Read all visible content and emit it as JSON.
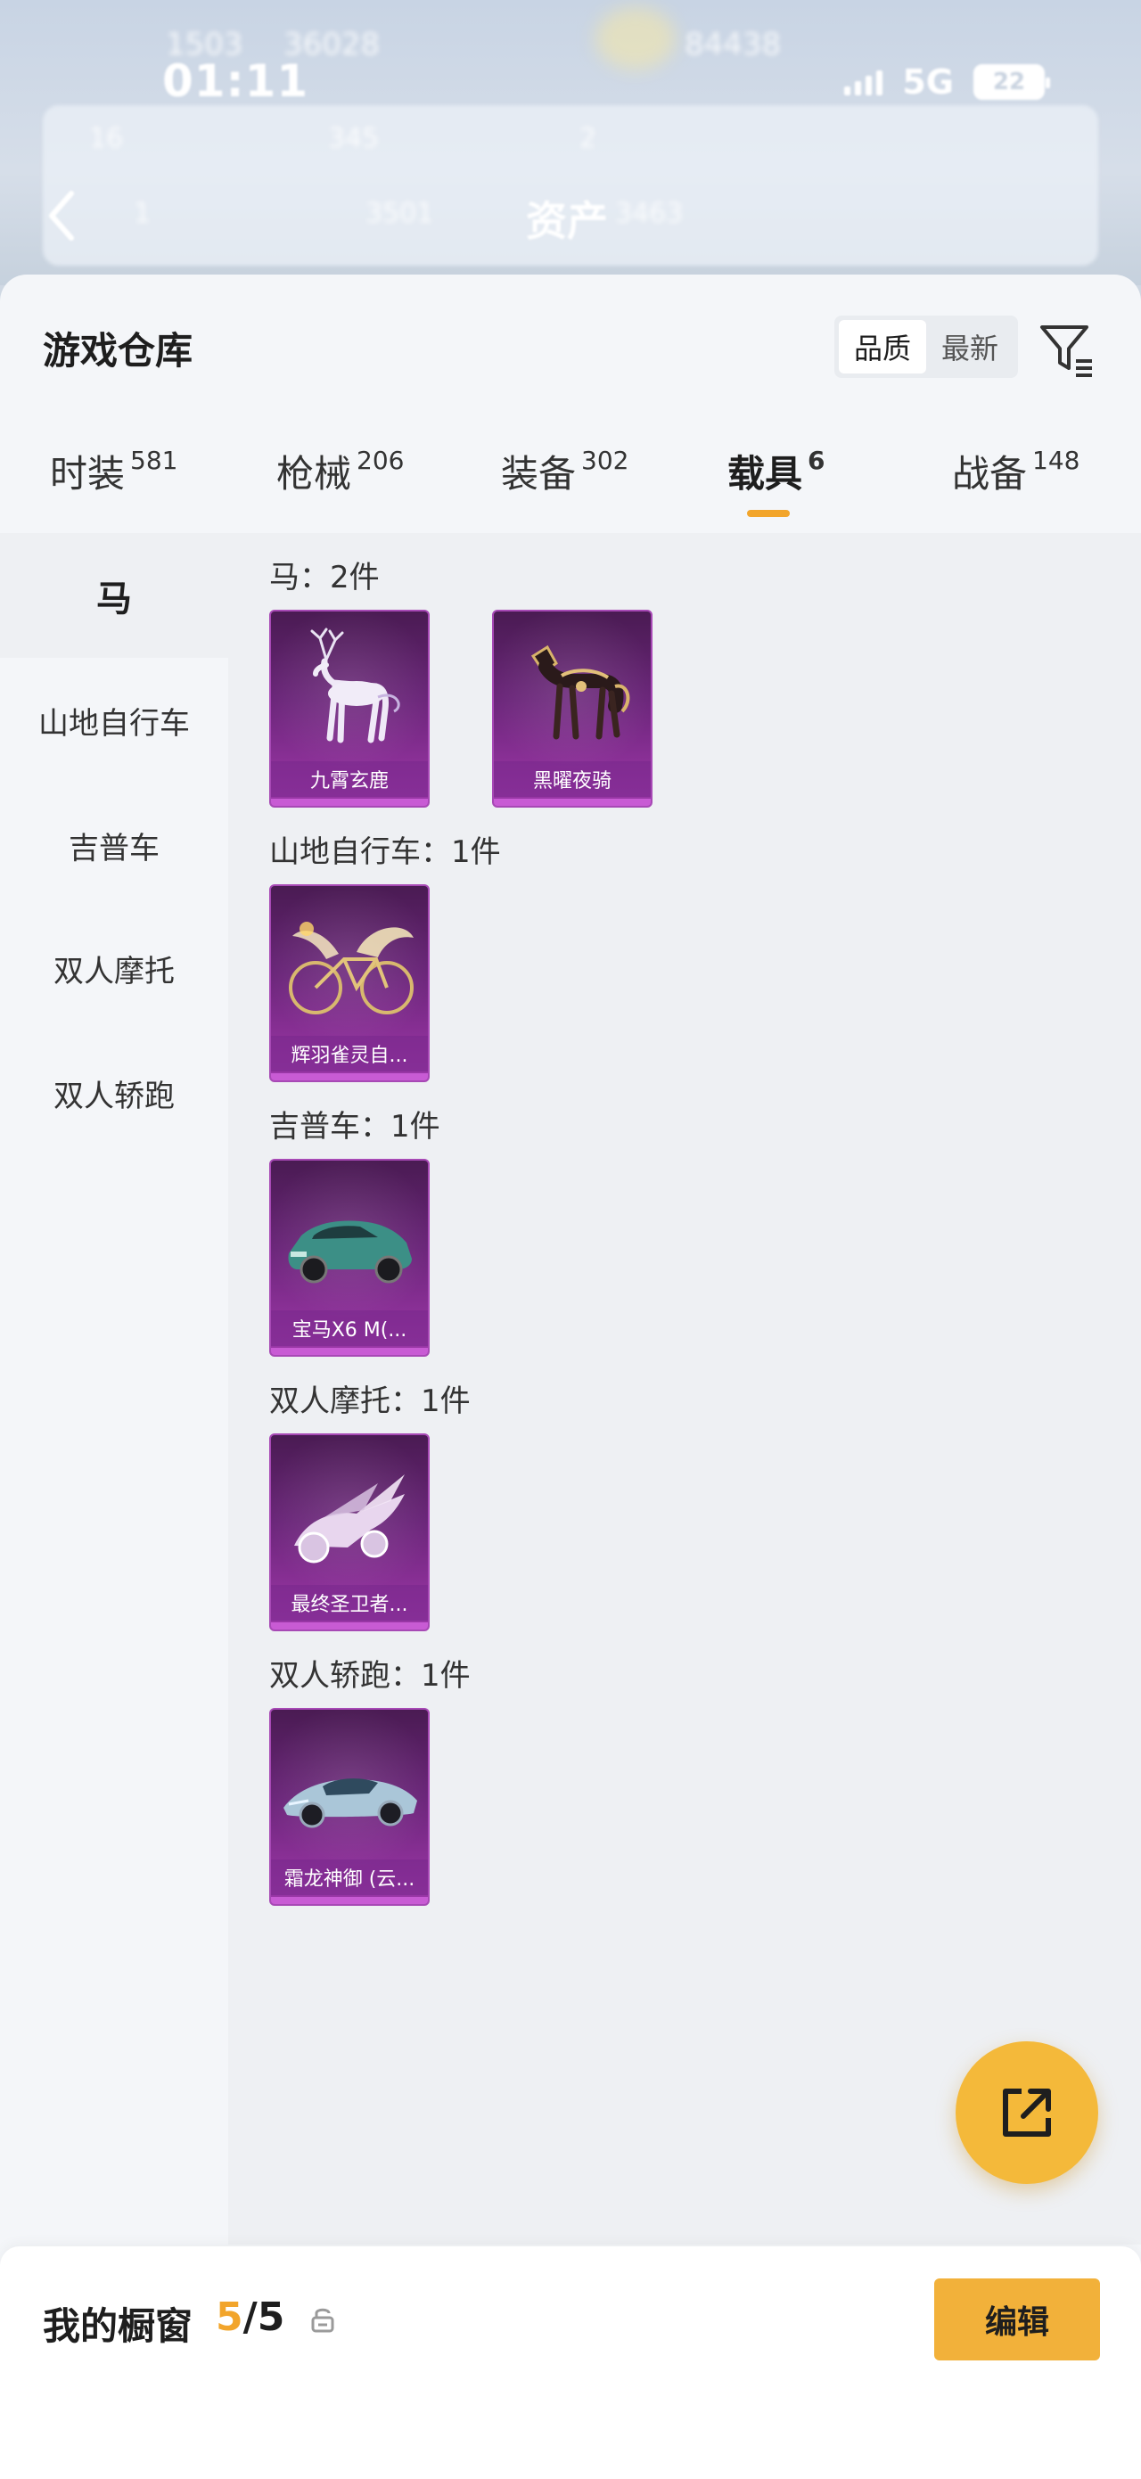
{
  "status_bar": {
    "time": "01:11",
    "network": "5G",
    "battery": "22"
  },
  "background": {
    "title": "资产",
    "blurred_texts": [
      "1503",
      "36028",
      "84438",
      "16",
      "345",
      "2",
      "1",
      "3501",
      "3463"
    ]
  },
  "sheet": {
    "title": "游戏仓库",
    "sort_options": [
      {
        "label": "品质",
        "active": true
      },
      {
        "label": "最新",
        "active": false
      }
    ]
  },
  "tabs": [
    {
      "label": "时装",
      "count": "581",
      "active": false
    },
    {
      "label": "枪械",
      "count": "206",
      "active": false
    },
    {
      "label": "装备",
      "count": "302",
      "active": false
    },
    {
      "label": "载具",
      "count": "6",
      "active": true
    },
    {
      "label": "战备",
      "count": "148",
      "active": false
    }
  ],
  "sidebar": {
    "items": [
      {
        "label": "马",
        "active": true
      },
      {
        "label": "山地自行车",
        "active": false
      },
      {
        "label": "吉普车",
        "active": false
      },
      {
        "label": "双人摩托",
        "active": false
      },
      {
        "label": "双人轿跑",
        "active": false
      }
    ]
  },
  "sections": [
    {
      "label": "马：2件",
      "items": [
        {
          "name": "九霄玄鹿",
          "icon": "deer-mount-icon"
        },
        {
          "name": "黑曜夜骑",
          "icon": "horse-mount-icon"
        }
      ]
    },
    {
      "label": "山地自行车：1件",
      "items": [
        {
          "name": "辉羽雀灵自...",
          "icon": "bike-icon"
        }
      ]
    },
    {
      "label": "吉普车：1件",
      "items": [
        {
          "name": "宝马X6 M(...",
          "icon": "car-icon"
        }
      ]
    },
    {
      "label": "双人摩托：1件",
      "items": [
        {
          "name": "最终圣卫者...",
          "icon": "motorcycle-icon"
        }
      ]
    },
    {
      "label": "双人轿跑：1件",
      "items": [
        {
          "name": "霜龙神御 (云...",
          "icon": "sportscar-icon"
        }
      ]
    }
  ],
  "footer": {
    "title": "我的橱窗",
    "count_current": "5",
    "count_total": "/5",
    "edit_label": "编辑"
  },
  "colors": {
    "accent": "#f2a52b",
    "card_purple": "#6a2579",
    "fab": "#f4b93a"
  }
}
